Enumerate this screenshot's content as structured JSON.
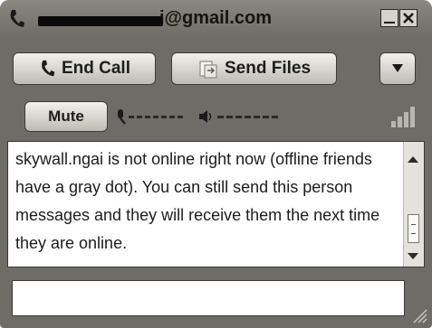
{
  "window": {
    "title_suffix": "i@gmail.com"
  },
  "toolbar": {
    "end_call_label": "End Call",
    "send_files_label": "Send Files",
    "mute_label": "Mute"
  },
  "chat": {
    "message": "skywall.ngai is not online right now (offline friends have a gray dot). You can still send this person messages and they will receive them the next time they are online."
  },
  "compose": {
    "value": ""
  },
  "icons": {
    "title": "phone-icon",
    "end_call": "phone-icon",
    "send_files": "file-transfer-icon",
    "more": "chevron-down-icon",
    "mic": "microphone-icon",
    "speaker": "speaker-icon",
    "signal": "signal-strength-icon"
  },
  "colors": {
    "window_bg": "#6e6c66",
    "button_face": "#d6d4cc",
    "text": "#1e1e1a"
  }
}
